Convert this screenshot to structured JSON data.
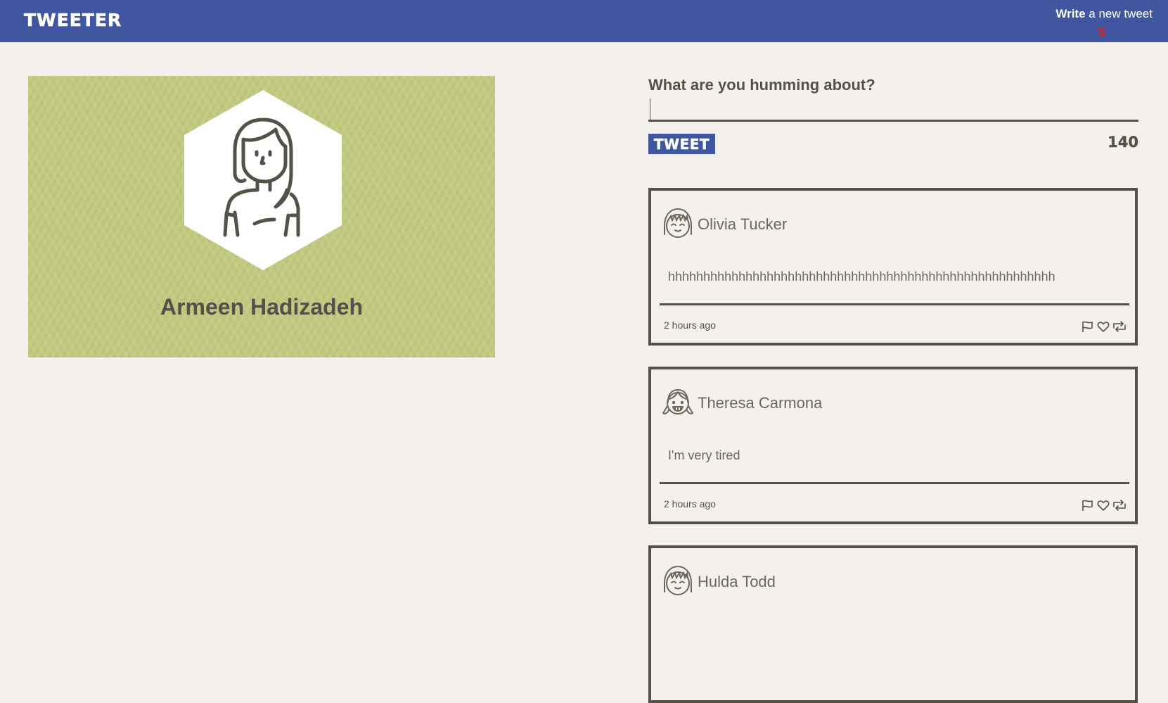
{
  "nav": {
    "brand": "TWEETER",
    "compose_bold": "Write",
    "compose_rest": " a new tweet",
    "arrow_icon": "double-chevron-down-icon",
    "arrow_color": "#d9232a"
  },
  "profile": {
    "name": "Armeen Hadizadeh",
    "avatar_icon": "woman-avatar-icon",
    "background_color": "#c1c97f"
  },
  "composer": {
    "label": "What are you humming about?",
    "value": "",
    "button_label": "TWEET",
    "counter": "140"
  },
  "tweets": [
    {
      "author": "Olivia Tucker",
      "avatar_icon": "girl-bangs-avatar-icon",
      "content": "hhhhhhhhhhhhhhhhhhhhhhhhhhhhhhhhhhhhhhhhhhhhhhhhhhhhhhh",
      "time": "2 hours ago"
    },
    {
      "author": "Theresa Carmona",
      "avatar_icon": "girl-pigtails-avatar-icon",
      "content": "I'm very tired",
      "time": "2 hours ago"
    },
    {
      "author": "Hulda Todd",
      "avatar_icon": "girl-bangs-avatar-icon",
      "content": "",
      "time": ""
    }
  ],
  "colors": {
    "nav_bg": "#4056a1",
    "page_bg": "#f4f1ec",
    "text": "#545149"
  }
}
